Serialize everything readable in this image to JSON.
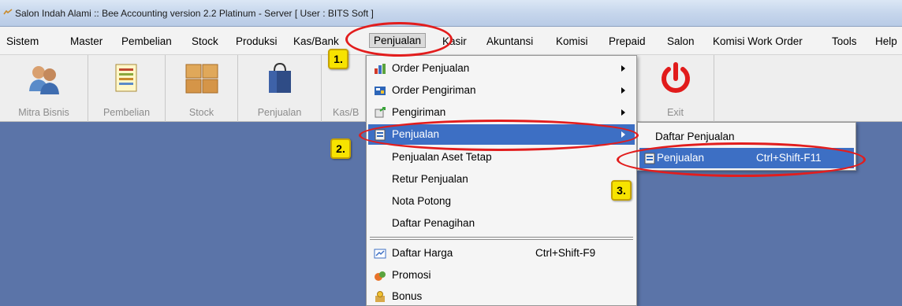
{
  "window": {
    "title": "Salon Indah Alami :: Bee Accounting version 2.2 Platinum - Server  [ User : BITS Soft ]"
  },
  "menubar": {
    "items": [
      "Sistem",
      "Master",
      "Pembelian",
      "Stock",
      "Produksi",
      "Kas/Bank",
      "Penjualan",
      "Kasir",
      "Akuntansi",
      "Komisi",
      "Prepaid",
      "Salon",
      "Komisi Work Order",
      "Tools",
      "Help"
    ]
  },
  "toolbar": {
    "buttons": [
      "Mitra Bisnis",
      "Pembelian",
      "Stock",
      "Penjualan",
      "Kas/B",
      "Exit"
    ]
  },
  "dropdown": {
    "items": [
      {
        "label": "Order Penjualan",
        "icon": "order-icon"
      },
      {
        "label": "Order Pengiriman",
        "icon": "shipping-order-icon"
      },
      {
        "label": "Pengiriman",
        "icon": "delivery-icon"
      },
      {
        "label": "Penjualan",
        "icon": "sales-icon"
      },
      {
        "label": "Penjualan Aset Tetap"
      },
      {
        "label": "Retur Penjualan"
      },
      {
        "label": "Nota Potong"
      },
      {
        "label": "Daftar Penagihan"
      },
      {
        "label": "Daftar Harga",
        "shortcut": "Ctrl+Shift-F9",
        "icon": "price-list-icon"
      },
      {
        "label": "Promosi",
        "icon": "promo-icon"
      },
      {
        "label": "Bonus",
        "icon": "bonus-icon"
      }
    ]
  },
  "submenu": {
    "items": [
      {
        "label": "Daftar Penjualan"
      },
      {
        "label": "Penjualan",
        "shortcut": "Ctrl+Shift-F11",
        "icon": "sales-icon"
      }
    ]
  },
  "annotations": {
    "badges": [
      "1.",
      "2.",
      "3."
    ],
    "color": "#e21d1d"
  },
  "colors": {
    "highlight": "#3d6fc4",
    "desktop": "#5b74a8",
    "exit_icon": "#e11b1b"
  }
}
